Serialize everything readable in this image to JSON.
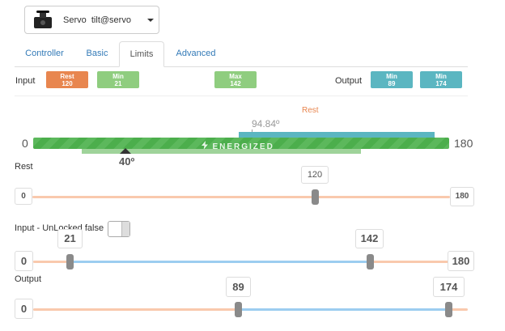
{
  "device": {
    "type_label": "Servo",
    "name": "tilt@servo"
  },
  "tabs": [
    {
      "label": "Controller"
    },
    {
      "label": "Basic"
    },
    {
      "label": "Limits",
      "active": true
    },
    {
      "label": "Advanced"
    }
  ],
  "info": {
    "input_label": "Input",
    "output_label": "Output",
    "rest": {
      "title": "Rest",
      "value": "120"
    },
    "input_min": {
      "title": "Min",
      "value": "21"
    },
    "input_max": {
      "title": "Max",
      "value": "142"
    },
    "output_min": {
      "title": "Min",
      "value": "89"
    },
    "output_max": {
      "title": "Min",
      "value": "174"
    }
  },
  "overview": {
    "rest_label": "Rest",
    "current_angle": "94.84º",
    "energized_label": "ENERGIZED",
    "range_min": "0",
    "range_max": "180",
    "position_label": "40º",
    "position_value": 40,
    "current_value": 94.84,
    "blue_range": [
      89,
      174
    ],
    "light_green_range": [
      21,
      142
    ]
  },
  "rest": {
    "label": "Rest",
    "min": "0",
    "max": "180",
    "value": "120"
  },
  "input": {
    "label": "Input - UnLocked false",
    "min": "0",
    "max": "180",
    "low": "21",
    "high": "142"
  },
  "output": {
    "label": "Output",
    "min": "0",
    "low": "89",
    "high": "174"
  },
  "colors": {
    "rest_badge": "#e8864f",
    "min_max_badge": "#8fcd7f",
    "output_badge": "#5bb6c1",
    "track_orange": "#f9c9ad",
    "track_blue": "#9ccdf0"
  }
}
